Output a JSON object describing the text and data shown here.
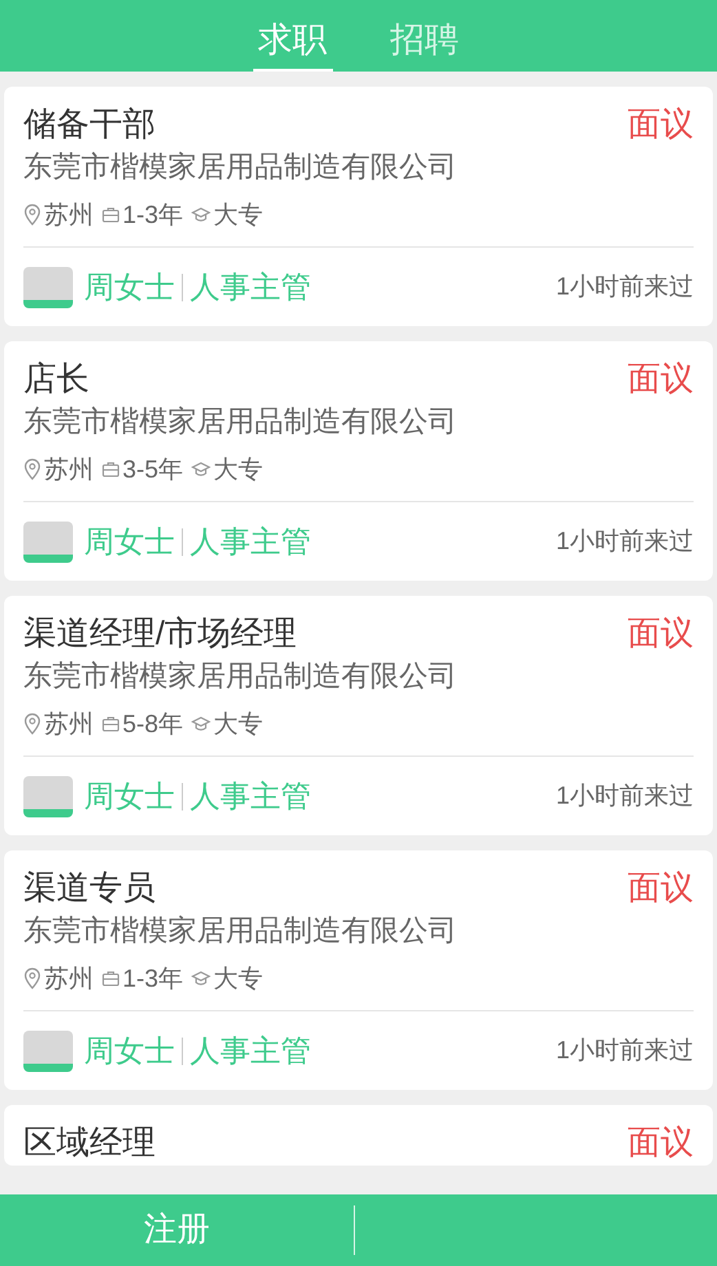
{
  "tabs": [
    {
      "label": "求职",
      "selected": true
    },
    {
      "label": "招聘",
      "selected": false
    }
  ],
  "jobs": [
    {
      "title": "储备干部",
      "salary": "面议",
      "company": "东莞市楷模家居用品制造有限公司",
      "location": "苏州",
      "experience": "1-3年",
      "education": "大专",
      "contact_name": "周女士",
      "contact_role": "人事主管",
      "last_seen": "1小时前来过"
    },
    {
      "title": "店长",
      "salary": "面议",
      "company": "东莞市楷模家居用品制造有限公司",
      "location": "苏州",
      "experience": "3-5年",
      "education": "大专",
      "contact_name": "周女士",
      "contact_role": "人事主管",
      "last_seen": "1小时前来过"
    },
    {
      "title": "渠道经理/市场经理",
      "salary": "面议",
      "company": "东莞市楷模家居用品制造有限公司",
      "location": "苏州",
      "experience": "5-8年",
      "education": "大专",
      "contact_name": "周女士",
      "contact_role": "人事主管",
      "last_seen": "1小时前来过"
    },
    {
      "title": "渠道专员",
      "salary": "面议",
      "company": "东莞市楷模家居用品制造有限公司",
      "location": "苏州",
      "experience": "1-3年",
      "education": "大专",
      "contact_name": "周女士",
      "contact_role": "人事主管",
      "last_seen": "1小时前来过"
    },
    {
      "title": "区域经理",
      "salary": "面议"
    }
  ],
  "footer": {
    "register_button": "注册"
  }
}
